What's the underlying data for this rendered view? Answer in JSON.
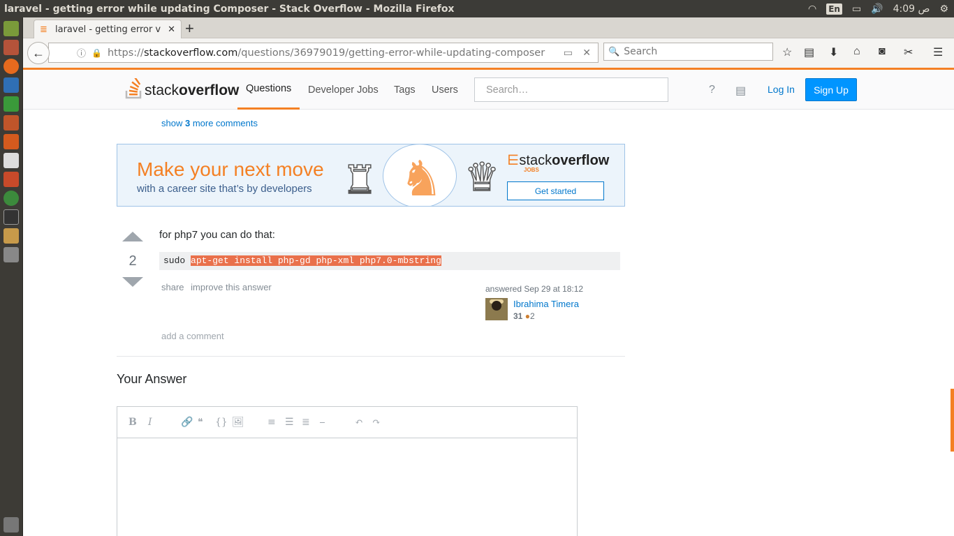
{
  "window": {
    "title": "laravel - getting error while updating Composer - Stack Overflow - Mozilla Firefox",
    "tray": {
      "lang": "En",
      "time": "4:09 ص"
    }
  },
  "browser": {
    "tab_title": "laravel - getting error v",
    "url_prefix": "https://",
    "url_domain": "stackoverflow.com",
    "url_path": "/questions/36979019/getting-error-while-updating-composer",
    "search_placeholder": "Search"
  },
  "so_header": {
    "logo_light": "stack",
    "logo_bold": "overflow",
    "nav": [
      "Questions",
      "Developer Jobs",
      "Tags",
      "Users"
    ],
    "search_placeholder": "Search…",
    "login": "Log In",
    "signup": "Sign Up"
  },
  "comments": {
    "show_prefix": "show ",
    "count": "3",
    "show_suffix": " more comments"
  },
  "ad": {
    "headline": "Make your next move",
    "subline": "with a career site that’s by developers",
    "brand_light": "stack",
    "brand_bold": "overflow",
    "brand_sub": "JOBS",
    "cta": "Get started"
  },
  "answer": {
    "votes": "2",
    "text": "for php7 you can do that:",
    "code_plain": "sudo ",
    "code_highlighted": "apt-get install php-gd php-xml php7.0-mbstring",
    "share": "share",
    "improve": "improve this answer",
    "answered": "answered Sep 29 at 18:12",
    "user_name": "Ibrahima Timera",
    "user_rep": "31",
    "user_bronze": "2",
    "add_comment": "add a comment"
  },
  "your_answer": {
    "heading": "Your Answer"
  },
  "editor": {
    "buttons": [
      "B",
      "I",
      "🔗",
      "❝",
      "{}",
      "🖼",
      "≡",
      "☰",
      "≣",
      "⎯",
      "↶",
      "↷"
    ]
  }
}
